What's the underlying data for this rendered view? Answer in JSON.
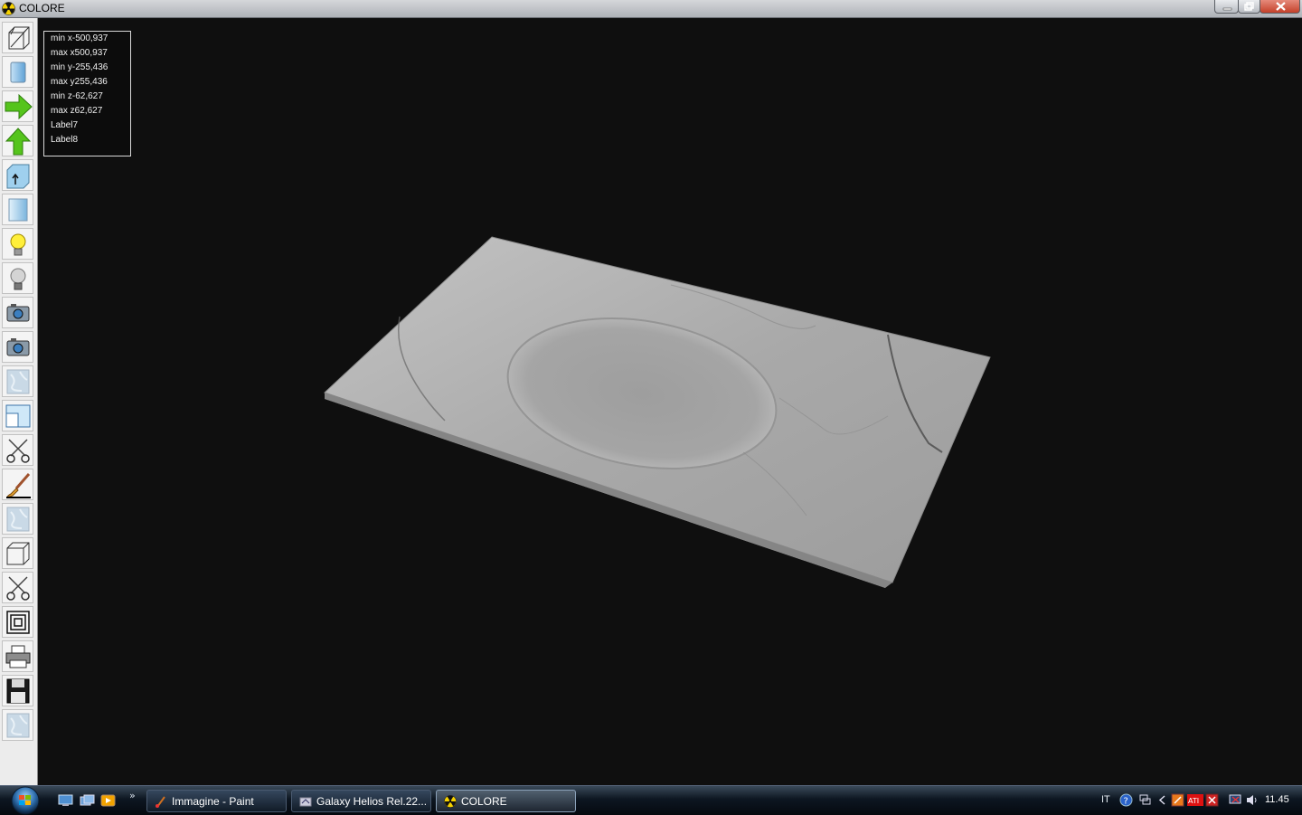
{
  "window": {
    "title": "COLORE",
    "icon": "radiation-icon"
  },
  "window_controls": [
    "minimize-icon",
    "restore-icon",
    "close-icon"
  ],
  "toolbar": {
    "tools": [
      "wireframe-icon",
      "solid-shading-icon",
      "arrow-right-icon",
      "arrow-up-icon",
      "texture-up-icon",
      "texture-panel-icon",
      "lightbulb-on-icon",
      "lightbulb-off-icon",
      "camera-icon",
      "camera-2-icon",
      "marble-texture-icon",
      "window-split-icon",
      "scissors-icon",
      "paintbrush-icon",
      "marble-texture-2-icon",
      "cube-icon",
      "scissors-2-icon",
      "nested-squares-icon",
      "printer-icon",
      "floppy-disk-icon",
      "marble-texture-3-icon"
    ]
  },
  "info": {
    "min_x": "min x-500,937",
    "max_x": "max x500,937",
    "min_y": "min y-255,436",
    "max_y": "max y255,436",
    "min_z": "min z-62,627",
    "max_z": "max z62,627",
    "label7": "Label7",
    "label8": "Label8"
  },
  "taskbar": {
    "start_icon": "windows-orb-icon",
    "quick_launch": [
      "show-desktop-icon",
      "switch-windows-icon",
      "media-player-icon"
    ],
    "more": "»",
    "tasks": [
      {
        "label": "Immagine - Paint",
        "icon": "paint-icon"
      },
      {
        "label": "Galaxy Helios  Rel.22...",
        "icon": "galaxy-helios-icon"
      },
      {
        "label": "COLORE",
        "icon": "radiation-icon"
      }
    ],
    "tray": {
      "language": "IT",
      "clock": "11.45",
      "icons": [
        "help-icon",
        "network-icon",
        "arrow-left-icon",
        "tray-app-icon",
        "ati-icon",
        "security-icon",
        "monitor-icon",
        "volume-icon"
      ]
    }
  }
}
